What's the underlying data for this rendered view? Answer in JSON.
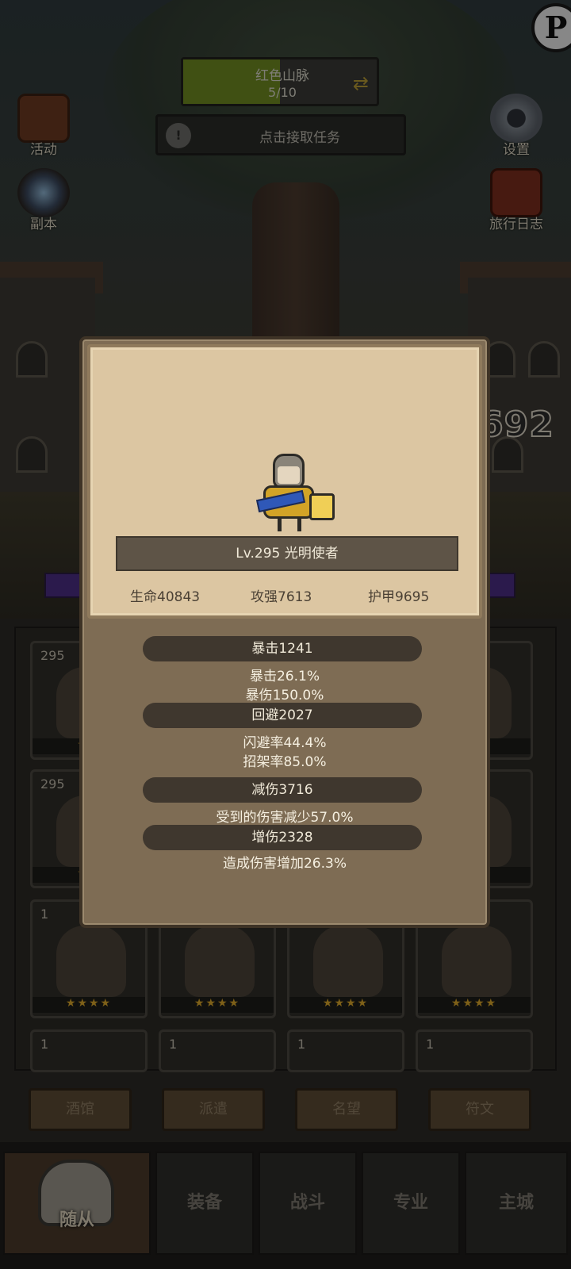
{
  "hud": {
    "region_name": "红色山脉",
    "region_progress": "5/10",
    "region_progress_fraction": 0.5,
    "quest_label": "点击接取任务"
  },
  "side_buttons": {
    "events": "活动",
    "dungeon": "副本",
    "settings": "设置",
    "journal": "旅行日志"
  },
  "damage_number": "692",
  "grid": {
    "cards": [
      {
        "level": "295",
        "stars": "★★"
      },
      {
        "level": "295",
        "stars": "★★"
      },
      {
        "level": "1",
        "stars": "★★★★"
      },
      {
        "level": "",
        "stars": "★★★★"
      },
      {
        "level": "",
        "stars": "★★★★"
      },
      {
        "level": "",
        "stars": "★★★★"
      },
      {
        "level": "1",
        "stars": ""
      },
      {
        "level": "1",
        "stars": ""
      },
      {
        "level": "1",
        "stars": ""
      },
      {
        "level": "1",
        "stars": ""
      }
    ]
  },
  "sub_tabs": [
    "酒馆",
    "派遣",
    "名望",
    "符文"
  ],
  "nav": {
    "followers": "随从",
    "equipment": "装备",
    "battle": "战斗",
    "profession": "专业",
    "main_city": "主城"
  },
  "hero": {
    "name_line": "Lv.295 光明使者",
    "hp": "生命40843",
    "attack": "攻强7613",
    "armor": "护甲9695"
  },
  "stats": {
    "crit_header": "暴击1241",
    "crit_rate": "暴击26.1%",
    "crit_damage": "暴伤150.0%",
    "dodge_header": "回避2027",
    "dodge_rate": "闪避率44.4%",
    "parry_rate": "招架率85.0%",
    "reduction_header": "减伤3716",
    "reduction_line": "受到的伤害减少57.0%",
    "damage_header": "增伤2328",
    "damage_line": "造成伤害增加26.3%"
  },
  "colors": {
    "popup_parchment": "#dcc6a2",
    "popup_frame": "#7e6c54",
    "stat_pill": "#3f372e",
    "progress_fill": "#6e8a22",
    "star": "#d9a62a"
  }
}
